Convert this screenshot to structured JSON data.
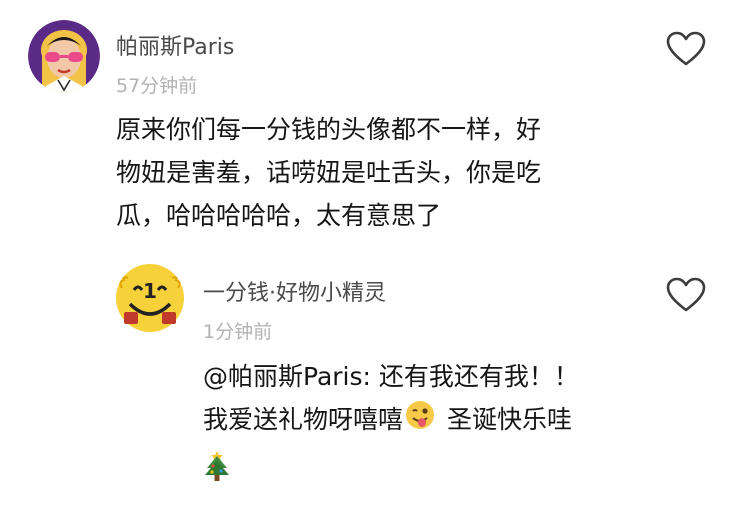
{
  "comments": [
    {
      "username": "帕丽斯Paris",
      "time": "57分钟前",
      "text_lines": [
        "原来你们每一分钱的头像都不一样，好",
        "物妞是害羞，话唠妞是吐舌头，你是吃",
        "瓜，哈哈哈哈哈，太有意思了"
      ],
      "like_icon": "heart-outline-icon",
      "avatar_icon": "pink-sunglasses-character-avatar"
    }
  ],
  "reply": {
    "username": "一分钱·好物小精灵",
    "time": "1分钟前",
    "line1": "@帕丽斯Paris: 还有我还有我！！",
    "line2_text": "我爱送礼物呀嘻嘻",
    "line2_after": "圣诞快乐哇",
    "emoji1": "winking-tongue-emoji",
    "emoji2": "christmas-tree-emoji",
    "like_icon": "heart-outline-icon",
    "avatar_icon": "yellow-smiley-coin-avatar"
  },
  "colors": {
    "name": "#4a4a4a",
    "time": "#b3b3b3",
    "text": "#161616",
    "heart": "#3d3d3d",
    "avatar_yellow": "#f7d13a",
    "avatar_purple": "#5b2a86"
  }
}
